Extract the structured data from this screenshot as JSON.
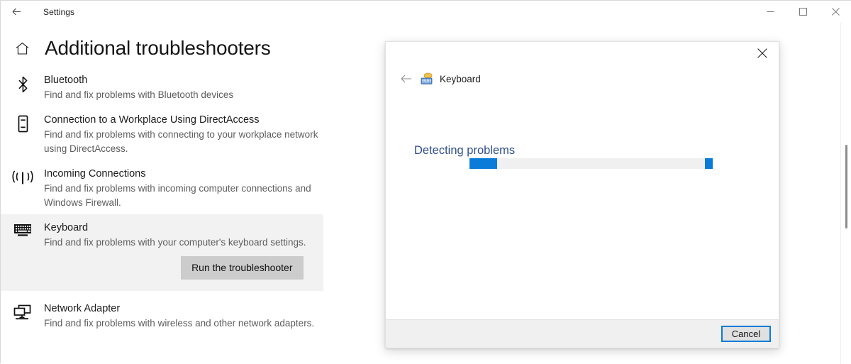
{
  "window": {
    "title": "Settings",
    "back_icon": "back-arrow-icon",
    "controls": {
      "minimize": "minimize-icon",
      "maximize": "maximize-icon",
      "close": "close-icon"
    }
  },
  "page": {
    "home_icon": "home-icon",
    "title": "Additional troubleshooters"
  },
  "troubleshooters": [
    {
      "icon": "bluetooth-icon",
      "name": "Bluetooth",
      "description": "Find and fix problems with Bluetooth devices",
      "selected": false
    },
    {
      "icon": "workplace-device-icon",
      "name": "Connection to a Workplace Using DirectAccess",
      "description": "Find and fix problems with connecting to your workplace network using DirectAccess.",
      "selected": false
    },
    {
      "icon": "incoming-connections-icon",
      "name": "Incoming Connections",
      "description": "Find and fix problems with incoming computer connections and Windows Firewall.",
      "selected": false
    },
    {
      "icon": "keyboard-icon",
      "name": "Keyboard",
      "description": "Find and fix problems with your computer's keyboard settings.",
      "selected": true,
      "action_label": "Run the troubleshooter"
    },
    {
      "icon": "network-adapter-icon",
      "name": "Network Adapter",
      "description": "Find and fix problems with wireless and other network adapters.",
      "selected": false
    }
  ],
  "dialog": {
    "close_icon": "close-icon",
    "back_icon": "back-arrow-icon",
    "app_icon": "keyboard-app-icon",
    "app_title": "Keyboard",
    "status_text": "Detecting problems",
    "cancel_label": "Cancel",
    "progress": {
      "style": "indeterminate-marquee",
      "accent_color": "#0a7bd8",
      "track_color": "#f0f0f0"
    }
  },
  "colors": {
    "accent": "#0a7bd8",
    "selected_row_bg": "#f2f2f2",
    "status_text": "#2f4e8e",
    "button_bg": "#cccccc"
  }
}
